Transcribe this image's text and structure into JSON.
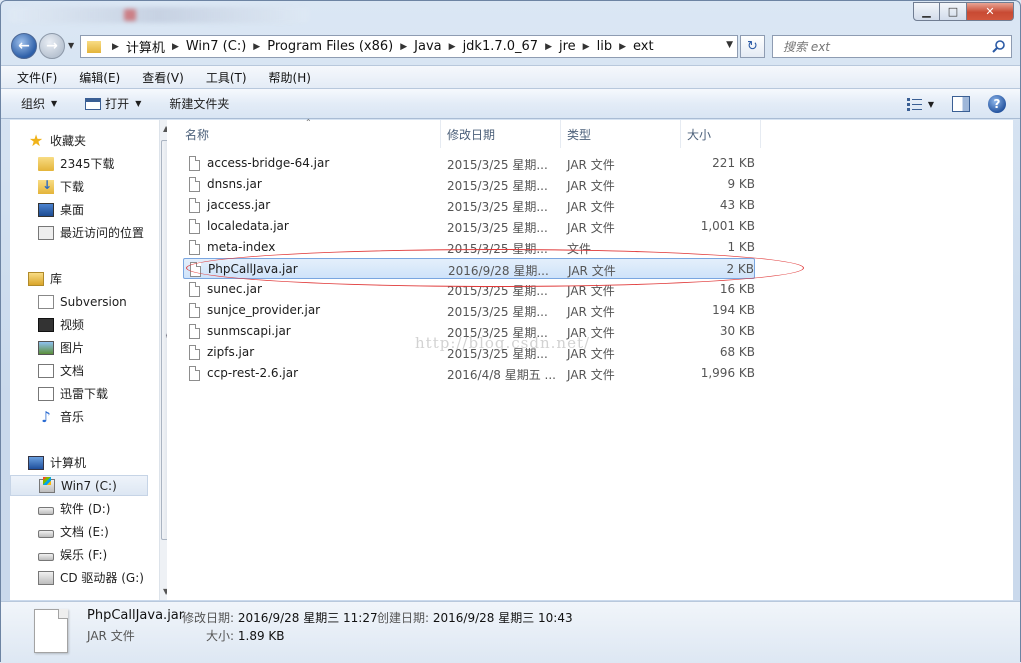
{
  "window": {
    "controls": {
      "minimize": "▁",
      "maximize": "□",
      "close": "✕"
    }
  },
  "nav": {
    "back_glyph": "←",
    "forward_glyph": "→",
    "breadcrumbs": [
      "计算机",
      "Win7 (C:)",
      "Program Files (x86)",
      "Java",
      "jdk1.7.0_67",
      "jre",
      "lib",
      "ext"
    ],
    "refresh_glyph": "↻",
    "search_placeholder": "搜索 ext"
  },
  "menubar": [
    "文件(F)",
    "编辑(E)",
    "查看(V)",
    "工具(T)",
    "帮助(H)"
  ],
  "toolbar": {
    "organize": "组织",
    "open": "打开",
    "new_folder": "新建文件夹",
    "help": "?"
  },
  "sidebar": {
    "favorites": {
      "label": "收藏夹",
      "items": [
        "2345下载",
        "下载",
        "桌面",
        "最近访问的位置"
      ]
    },
    "libraries": {
      "label": "库",
      "items": [
        "Subversion",
        "视频",
        "图片",
        "文档",
        "迅雷下载",
        "音乐"
      ]
    },
    "computer": {
      "label": "计算机",
      "items": [
        "Win7 (C:)",
        "软件 (D:)",
        "文档 (E:)",
        "娱乐 (F:)",
        "CD 驱动器 (G:)"
      ]
    }
  },
  "columns": {
    "name": "名称",
    "date": "修改日期",
    "type": "类型",
    "size": "大小"
  },
  "files": [
    {
      "name": "access-bridge-64.jar",
      "date": "2015/3/25 星期...",
      "type": "JAR 文件",
      "size": "221 KB"
    },
    {
      "name": "dnsns.jar",
      "date": "2015/3/25 星期...",
      "type": "JAR 文件",
      "size": "9 KB"
    },
    {
      "name": "jaccess.jar",
      "date": "2015/3/25 星期...",
      "type": "JAR 文件",
      "size": "43 KB"
    },
    {
      "name": "localedata.jar",
      "date": "2015/3/25 星期...",
      "type": "JAR 文件",
      "size": "1,001 KB"
    },
    {
      "name": "meta-index",
      "date": "2015/3/25 星期...",
      "type": "文件",
      "size": "1 KB"
    },
    {
      "name": "PhpCallJava.jar",
      "date": "2016/9/28 星期...",
      "type": "JAR 文件",
      "size": "2 KB"
    },
    {
      "name": "sunec.jar",
      "date": "2015/3/25 星期...",
      "type": "JAR 文件",
      "size": "16 KB"
    },
    {
      "name": "sunjce_provider.jar",
      "date": "2015/3/25 星期...",
      "type": "JAR 文件",
      "size": "194 KB"
    },
    {
      "name": "sunmscapi.jar",
      "date": "2015/3/25 星期...",
      "type": "JAR 文件",
      "size": "30 KB"
    },
    {
      "name": "zipfs.jar",
      "date": "2015/3/25 星期...",
      "type": "JAR 文件",
      "size": "68 KB"
    },
    {
      "name": "ccp-rest-2.6.jar",
      "date": "2016/4/8 星期五 ...",
      "type": "JAR 文件",
      "size": "1,996 KB"
    }
  ],
  "watermark": "http://blog.csdn.net/",
  "details": {
    "name": "PhpCallJava.jar",
    "type": "JAR 文件",
    "modified_label": "修改日期:",
    "modified_value": "2016/9/28 星期三 11:27",
    "created_label": "创建日期:",
    "created_value": "2016/9/28 星期三 10:43",
    "size_label": "大小:",
    "size_value": "1.89 KB"
  },
  "colors": {
    "selection_border": "#7aa6e0",
    "annotation_red": "#e03a3a"
  }
}
